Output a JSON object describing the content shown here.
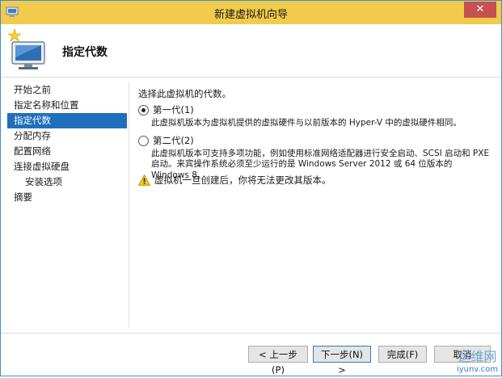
{
  "window": {
    "title": "新建虚拟机向导",
    "close_label": "✕"
  },
  "header": {
    "title": "指定代数"
  },
  "nav": {
    "items": [
      {
        "label": "开始之前",
        "active": false,
        "sub": false
      },
      {
        "label": "指定名称和位置",
        "active": false,
        "sub": false
      },
      {
        "label": "指定代数",
        "active": true,
        "sub": false
      },
      {
        "label": "分配内存",
        "active": false,
        "sub": false
      },
      {
        "label": "配置网络",
        "active": false,
        "sub": false
      },
      {
        "label": "连接虚拟硬盘",
        "active": false,
        "sub": false
      },
      {
        "label": "安装选项",
        "active": false,
        "sub": true
      },
      {
        "label": "摘要",
        "active": false,
        "sub": false
      }
    ]
  },
  "content": {
    "prompt": "选择此虚拟机的代数。",
    "gen1": {
      "label": "第一代(1)",
      "selected": true,
      "desc": "此虚拟机版本为虚拟机提供的虚拟硬件与以前版本的 Hyper-V 中的虚拟硬件相同。"
    },
    "gen2": {
      "label": "第二代(2)",
      "selected": false,
      "desc_line1": "此虚拟机版本可支持多项功能，例如使用标准网络适配器进行安全启动、SCSI 启动和 PXE",
      "desc_line2": "启动。来宾操作系统必须至少运行的是 Windows Server 2012 或 64 位版本的 Windows 8。"
    },
    "warning": "虚拟机一旦创建后，你将无法更改其版本。"
  },
  "buttons": {
    "prev": "< 上一步(P)",
    "next": "下一步(N) >",
    "finish": "完成(F)",
    "cancel": "取消"
  },
  "watermark": {
    "text": "运维网",
    "url": "iyunv.com"
  },
  "colors": {
    "titlebar": "#f1cb4c",
    "accent": "#1f6fba",
    "close": "#c75050",
    "warning": "#f5c518"
  }
}
